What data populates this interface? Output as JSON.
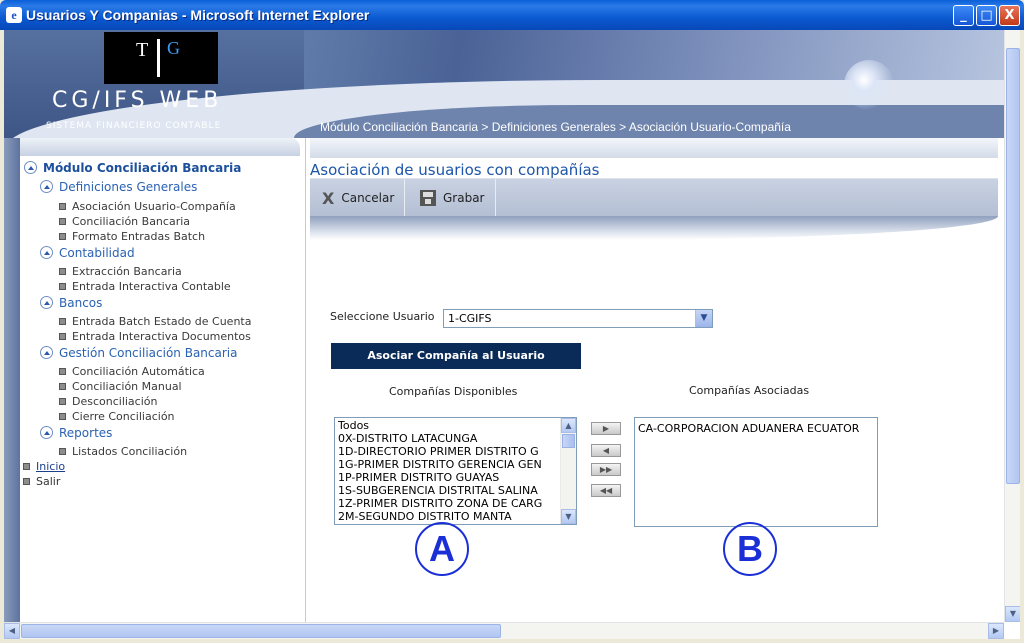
{
  "window": {
    "title": "Usuarios Y Companias - Microsoft Internet Explorer",
    "minimize": "_",
    "maximize": "□",
    "close": "X"
  },
  "banner": {
    "logo_t": "T",
    "logo_g": "G",
    "brand": "CG/IFS WEB",
    "brand_sub": "SISTEMA FINANCIERO CONTABLE",
    "breadcrumb": "Módulo Conciliación Bancaria > Definiciones Generales > Asociación Usuario-Compañía"
  },
  "sidebar": {
    "module": "Módulo Conciliación Bancaria",
    "groups": [
      {
        "label": "Definiciones Generales",
        "items": [
          "Asociación Usuario-Compañía",
          "Conciliación Bancaria",
          "Formato Entradas Batch"
        ]
      },
      {
        "label": "Contabilidad",
        "items": [
          "Extracción Bancaria",
          "Entrada Interactiva Contable"
        ]
      },
      {
        "label": "Bancos",
        "items": [
          "Entrada Batch Estado de Cuenta",
          "Entrada Interactiva Documentos"
        ]
      },
      {
        "label": "Gestión Conciliación Bancaria",
        "items": [
          "Conciliación Automática",
          "Conciliación Manual",
          "Desconciliación",
          "Cierre Conciliación"
        ]
      },
      {
        "label": "Reportes",
        "items": [
          "Listados Conciliación"
        ]
      }
    ],
    "inicio": "Inicio",
    "salir": "Salir"
  },
  "content": {
    "page_title": "Asociación de usuarios con compañías",
    "toolbar": {
      "cancel": "Cancelar",
      "cancel_icon": "X",
      "save": "Grabar"
    },
    "user_label": "Seleccione Usuario",
    "user_selected": "1-CGIFS",
    "assoc_button": "Asociar Compañía al Usuario",
    "available_label": "Compañías Disponibles",
    "associated_label": "Compañías Asociadas",
    "available": [
      "Todos",
      "0X-DISTRITO LATACUNGA",
      "1D-DIRECTORIO PRIMER DISTRITO G",
      "1G-PRIMER DISTRITO GERENCIA GEN",
      "1P-PRIMER DISTRITO GUAYAS",
      "1S-SUBGERENCIA DISTRITAL SALINA",
      "1Z-PRIMER DISTRITO ZONA DE CARG",
      "2M-SEGUNDO DISTRITO MANTA"
    ],
    "associated": [
      "CA-CORPORACION ADUANERA ECUATOR"
    ],
    "move_buttons": [
      "▶",
      "◀",
      "▶▶",
      "◀◀"
    ],
    "annot_a": "A",
    "annot_b": "B"
  }
}
